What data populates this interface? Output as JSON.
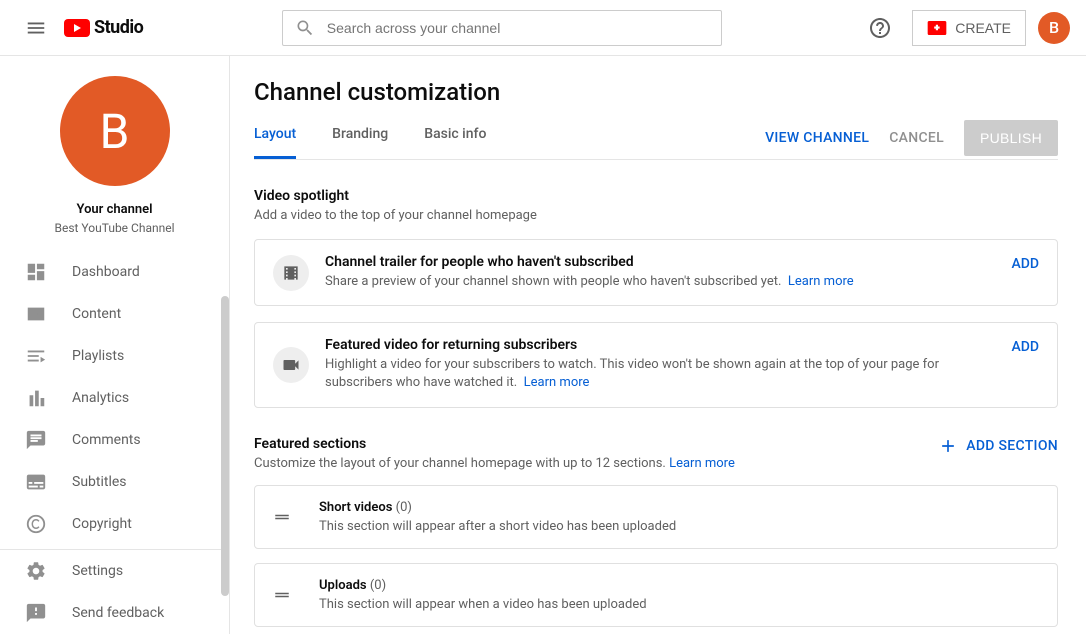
{
  "header": {
    "logo_text": "Studio",
    "search_placeholder": "Search across your channel",
    "create_label": "CREATE",
    "avatar_letter": "B"
  },
  "sidebar": {
    "avatar_letter": "B",
    "your_channel": "Your channel",
    "channel_name": "Best YouTube Channel",
    "nav": [
      {
        "label": "Dashboard"
      },
      {
        "label": "Content"
      },
      {
        "label": "Playlists"
      },
      {
        "label": "Analytics"
      },
      {
        "label": "Comments"
      },
      {
        "label": "Subtitles"
      },
      {
        "label": "Copyright"
      }
    ],
    "bottom": [
      {
        "label": "Settings"
      },
      {
        "label": "Send feedback"
      }
    ]
  },
  "page": {
    "title": "Channel customization",
    "tabs": [
      "Layout",
      "Branding",
      "Basic info"
    ],
    "actions": {
      "view_channel": "VIEW CHANNEL",
      "cancel": "CANCEL",
      "publish": "PUBLISH"
    },
    "spotlight": {
      "title": "Video spotlight",
      "subtitle": "Add a video to the top of your channel homepage",
      "cards": [
        {
          "title": "Channel trailer for people who haven't subscribed",
          "desc": "Share a preview of your channel shown with people who haven't subscribed yet.",
          "learn": "Learn more",
          "add": "ADD"
        },
        {
          "title": "Featured video for returning subscribers",
          "desc": "Highlight a video for your subscribers to watch. This video won't be shown again at the top of your page for subscribers who have watched it.",
          "learn": "Learn more",
          "add": "ADD"
        }
      ]
    },
    "featured": {
      "title": "Featured sections",
      "subtitle": "Customize the layout of your channel homepage with up to 12 sections.",
      "learn": "Learn more",
      "add_btn": "ADD SECTION",
      "items": [
        {
          "title": "Short videos",
          "count": "(0)",
          "desc": "This section will appear after a short video has been uploaded"
        },
        {
          "title": "Uploads",
          "count": "(0)",
          "desc": "This section will appear when a video has been uploaded"
        }
      ]
    }
  }
}
